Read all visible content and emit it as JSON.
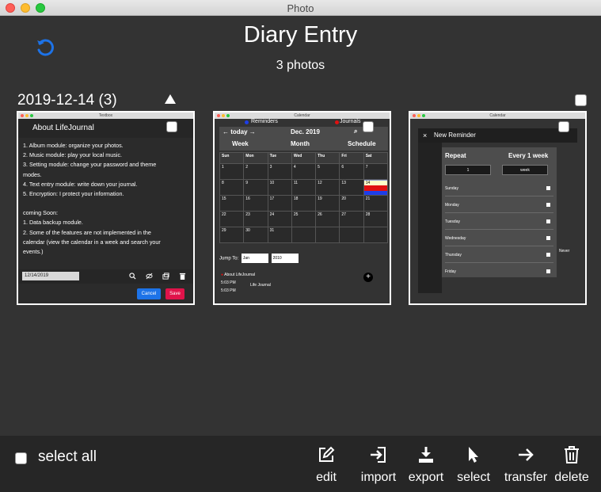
{
  "window": {
    "title": "Photo"
  },
  "header": {
    "title": "Diary Entry",
    "subtitle": "3 photos"
  },
  "group": {
    "title": "2019-12-14 (3)"
  },
  "thumbs": [
    {
      "window_title": "Textbox",
      "heading": "About LifeJournal",
      "lines": [
        "1. Album module: organize your photos.",
        "2. Music module: play your local music.",
        "3. Setting module: change your password and theme",
        "modes.",
        "4. Text entry module: write down your journal.",
        "5. Encryption: I protect your information.",
        "",
        "coming Soon:",
        "1. Data backup module.",
        "2. Some of the features are not implemented in the",
        "calendar (view the calendar in a week and search your",
        "events.)"
      ],
      "date": "12/14/2019",
      "cancel": "Cancel",
      "save": "Save"
    },
    {
      "window_title": "Calendar",
      "reminders": "Reminders",
      "journals": "Journals",
      "today": "today",
      "month_label": "Dec. 2019",
      "views": [
        "Week",
        "Month",
        "Schedule"
      ],
      "weekdays": [
        "Sun",
        "Mon",
        "Tue",
        "Wed",
        "Thu",
        "Fri",
        "Sat"
      ],
      "weeks": [
        [
          "1",
          "2",
          "3",
          "4",
          "5",
          "6",
          "7"
        ],
        [
          "8",
          "9",
          "10",
          "11",
          "12",
          "13",
          "14"
        ],
        [
          "15",
          "16",
          "17",
          "18",
          "19",
          "20",
          "21"
        ],
        [
          "22",
          "23",
          "24",
          "25",
          "26",
          "27",
          "28"
        ],
        [
          "29",
          "30",
          "31",
          "",
          "",
          "",
          ""
        ]
      ],
      "jump_to": "Jump To:",
      "jump_month": "Jan",
      "jump_year": "2010",
      "list_item": "About LifeJournal",
      "time1": "5:03 PM",
      "time2": "5:03 PM",
      "time_label": "Life Journal"
    },
    {
      "window_title": "Calendar",
      "heading": "New Reminder",
      "repeat": "Repeat",
      "every": "Every 1 week",
      "count": "1",
      "unit": "week",
      "days": [
        "Sunday",
        "Monday",
        "Tuesday",
        "Wednesday",
        "Thursday",
        "Friday"
      ],
      "never": "Never"
    }
  ],
  "footer": {
    "select_all": "select all",
    "actions": [
      {
        "label": "edit",
        "icon": "edit-icon"
      },
      {
        "label": "import",
        "icon": "import-icon"
      },
      {
        "label": "export",
        "icon": "export-icon"
      },
      {
        "label": "select",
        "icon": "cursor-icon"
      },
      {
        "label": "transfer",
        "icon": "arrow-right-icon"
      },
      {
        "label": "delete",
        "icon": "trash-icon"
      }
    ]
  },
  "colors": {
    "accent": "#1d73e8",
    "danger": "#e0134a",
    "background": "#333333",
    "bar": "#262626"
  }
}
